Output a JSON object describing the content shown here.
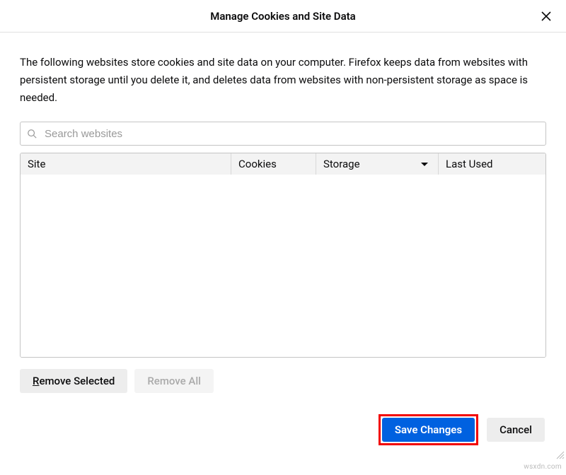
{
  "dialog": {
    "title": "Manage Cookies and Site Data",
    "description": "The following websites store cookies and site data on your computer. Firefox keeps data from websites with persistent storage until you delete it, and deletes data from websites with non-persistent storage as space is needed."
  },
  "search": {
    "placeholder": "Search websites",
    "value": ""
  },
  "table": {
    "columns": {
      "site": "Site",
      "cookies": "Cookies",
      "storage": "Storage",
      "last_used": "Last Used"
    },
    "sorted_column": "storage",
    "sort_direction": "desc",
    "rows": []
  },
  "actions": {
    "remove_selected": "Remove Selected",
    "remove_all": "Remove All"
  },
  "footer": {
    "save": "Save Changes",
    "cancel": "Cancel"
  },
  "watermark": "wsxdn.com"
}
